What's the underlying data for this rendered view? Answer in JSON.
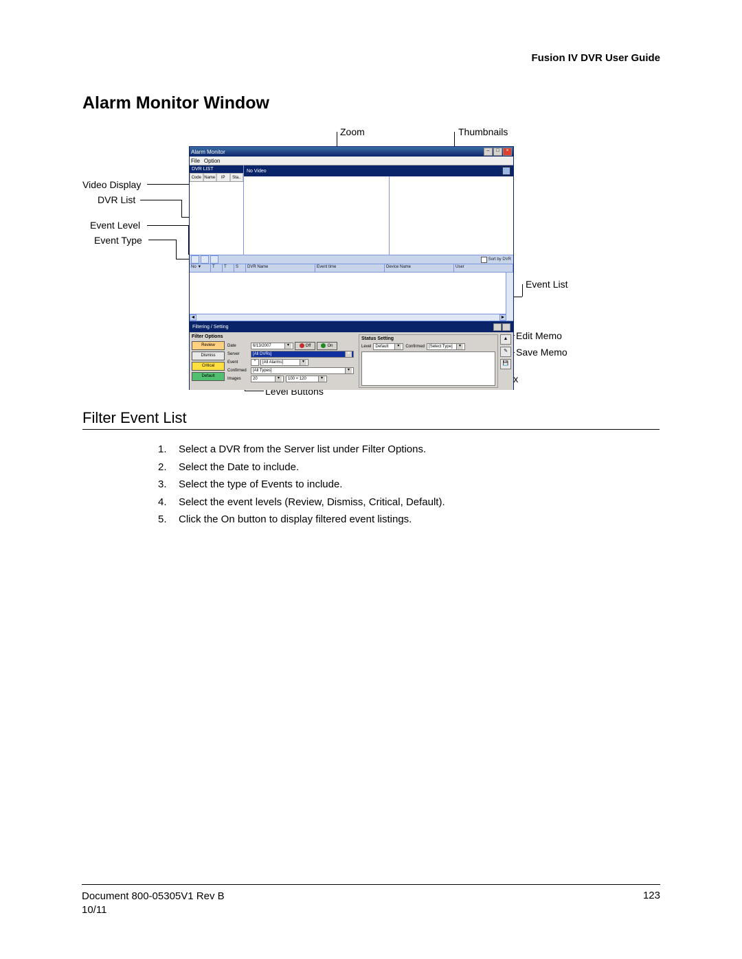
{
  "doc": {
    "header": "Fusion IV DVR User Guide",
    "h1": "Alarm Monitor Window",
    "h2": "Filter Event List",
    "steps": [
      "Select a DVR from the Server list under Filter Options.",
      "Select the Date to include.",
      "Select the type of Events to include.",
      "Select the event levels (Review, Dismiss, Critical, Default).",
      "Click the On button to display filtered event listings."
    ],
    "footer_doc": "Document 800-05305V1 Rev B",
    "footer_date": "10/11",
    "page_number": "123"
  },
  "callouts": {
    "zoom": "Zoom",
    "thumbnails": "Thumbnails",
    "video_display": "Video Display",
    "dvr_list": "DVR List",
    "event_level": "Event Level",
    "event_type": "Event Type",
    "event_list": "Event List",
    "edit_memo": "Edit Memo",
    "save_memo": "Save Memo",
    "memo_text_box": "Memo Text Box",
    "level_buttons": "Level Buttons"
  },
  "amw": {
    "title": "Alarm Monitor",
    "menu": {
      "file": "File",
      "option": "Option"
    },
    "dvrlist": {
      "header": "DVR LIST",
      "tabs": [
        "Code",
        "Name",
        "IP",
        "Sta.."
      ]
    },
    "novideo_label": "No Video",
    "sort_by_dvr": "Sort by DVR",
    "columns": {
      "no": "No ▼",
      "t": "T",
      "t2": "T",
      "s": "S",
      "dvr_name": "DVR Name",
      "event_time": "Event time",
      "device_name": "Device Name",
      "user": "User"
    },
    "filter_setting": {
      "title": "Filtering / Setting",
      "filter_options_label": "Filter Options",
      "status_setting_label": "Status Setting",
      "level_buttons": {
        "review": "Review",
        "dismiss": "Dismiss",
        "critical": "Critical",
        "default": "Default"
      },
      "fields": {
        "date_label": "Date",
        "date_value": "6/13/2007",
        "off": "Off",
        "on": "On",
        "server_label": "Server",
        "server_value": "[All DVRs]",
        "event_label": "Event",
        "event_chk": "*",
        "event_value": "[All Alarms]",
        "confirmed_label": "Confirmed",
        "confirmed_value": "[All Types]",
        "images_label": "Images",
        "images_count": "20",
        "images_size": "100 × 120"
      },
      "status": {
        "level_label": "Level",
        "level_value": "Default",
        "confirmed_label": "Confirmed",
        "confirmed_value": "[Select Type]"
      },
      "side": {
        "up": "▲",
        "edit": "✎",
        "save": "💾"
      }
    }
  }
}
